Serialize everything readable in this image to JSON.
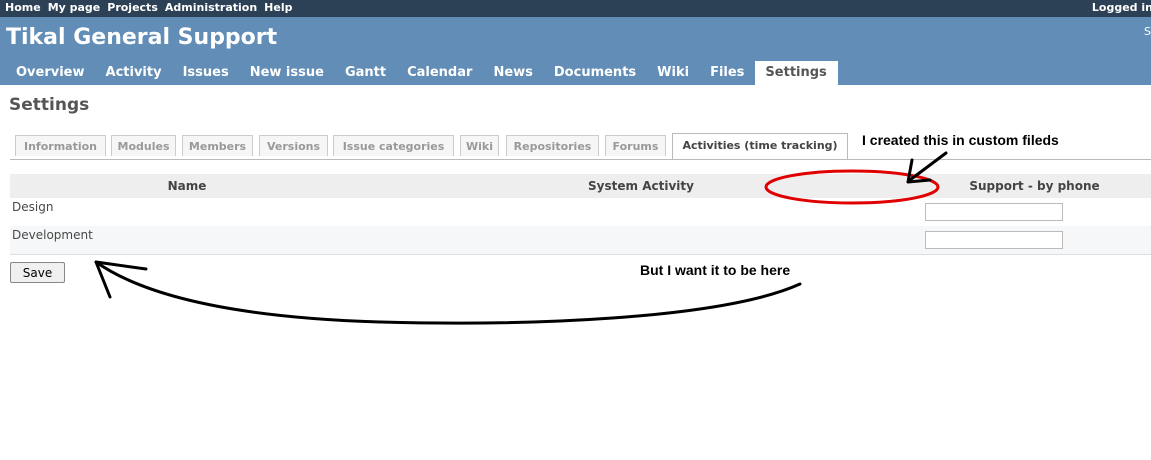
{
  "top_menu": {
    "items": [
      "Home",
      "My page",
      "Projects",
      "Administration",
      "Help"
    ],
    "logged_in": "Logged in"
  },
  "header": {
    "project_title": "Tikal General Support",
    "corner_text": "S"
  },
  "main_menu": {
    "tabs": [
      "Overview",
      "Activity",
      "Issues",
      "New issue",
      "Gantt",
      "Calendar",
      "News",
      "Documents",
      "Wiki",
      "Files",
      "Settings"
    ],
    "selected": "Settings"
  },
  "page": {
    "title": "Settings"
  },
  "settings_tabs": {
    "items": [
      "Information",
      "Modules",
      "Members",
      "Versions",
      "Issue categories",
      "Wiki",
      "Repositories",
      "Forums",
      "Activities (time tracking)"
    ],
    "selected": "Activities (time tracking)"
  },
  "activities_table": {
    "headers": [
      "Name",
      "System Activity",
      "Support - by phone"
    ],
    "rows": [
      {
        "name": "Design",
        "value": ""
      },
      {
        "name": "Development",
        "value": ""
      }
    ]
  },
  "save_button": "Save",
  "annotations": {
    "note_top": "I created this in custom fileds",
    "note_bottom": "But I want it to be here",
    "highlight_color": "#e00000"
  },
  "colors": {
    "top_bar": "#2c4056",
    "header": "#628db6"
  }
}
